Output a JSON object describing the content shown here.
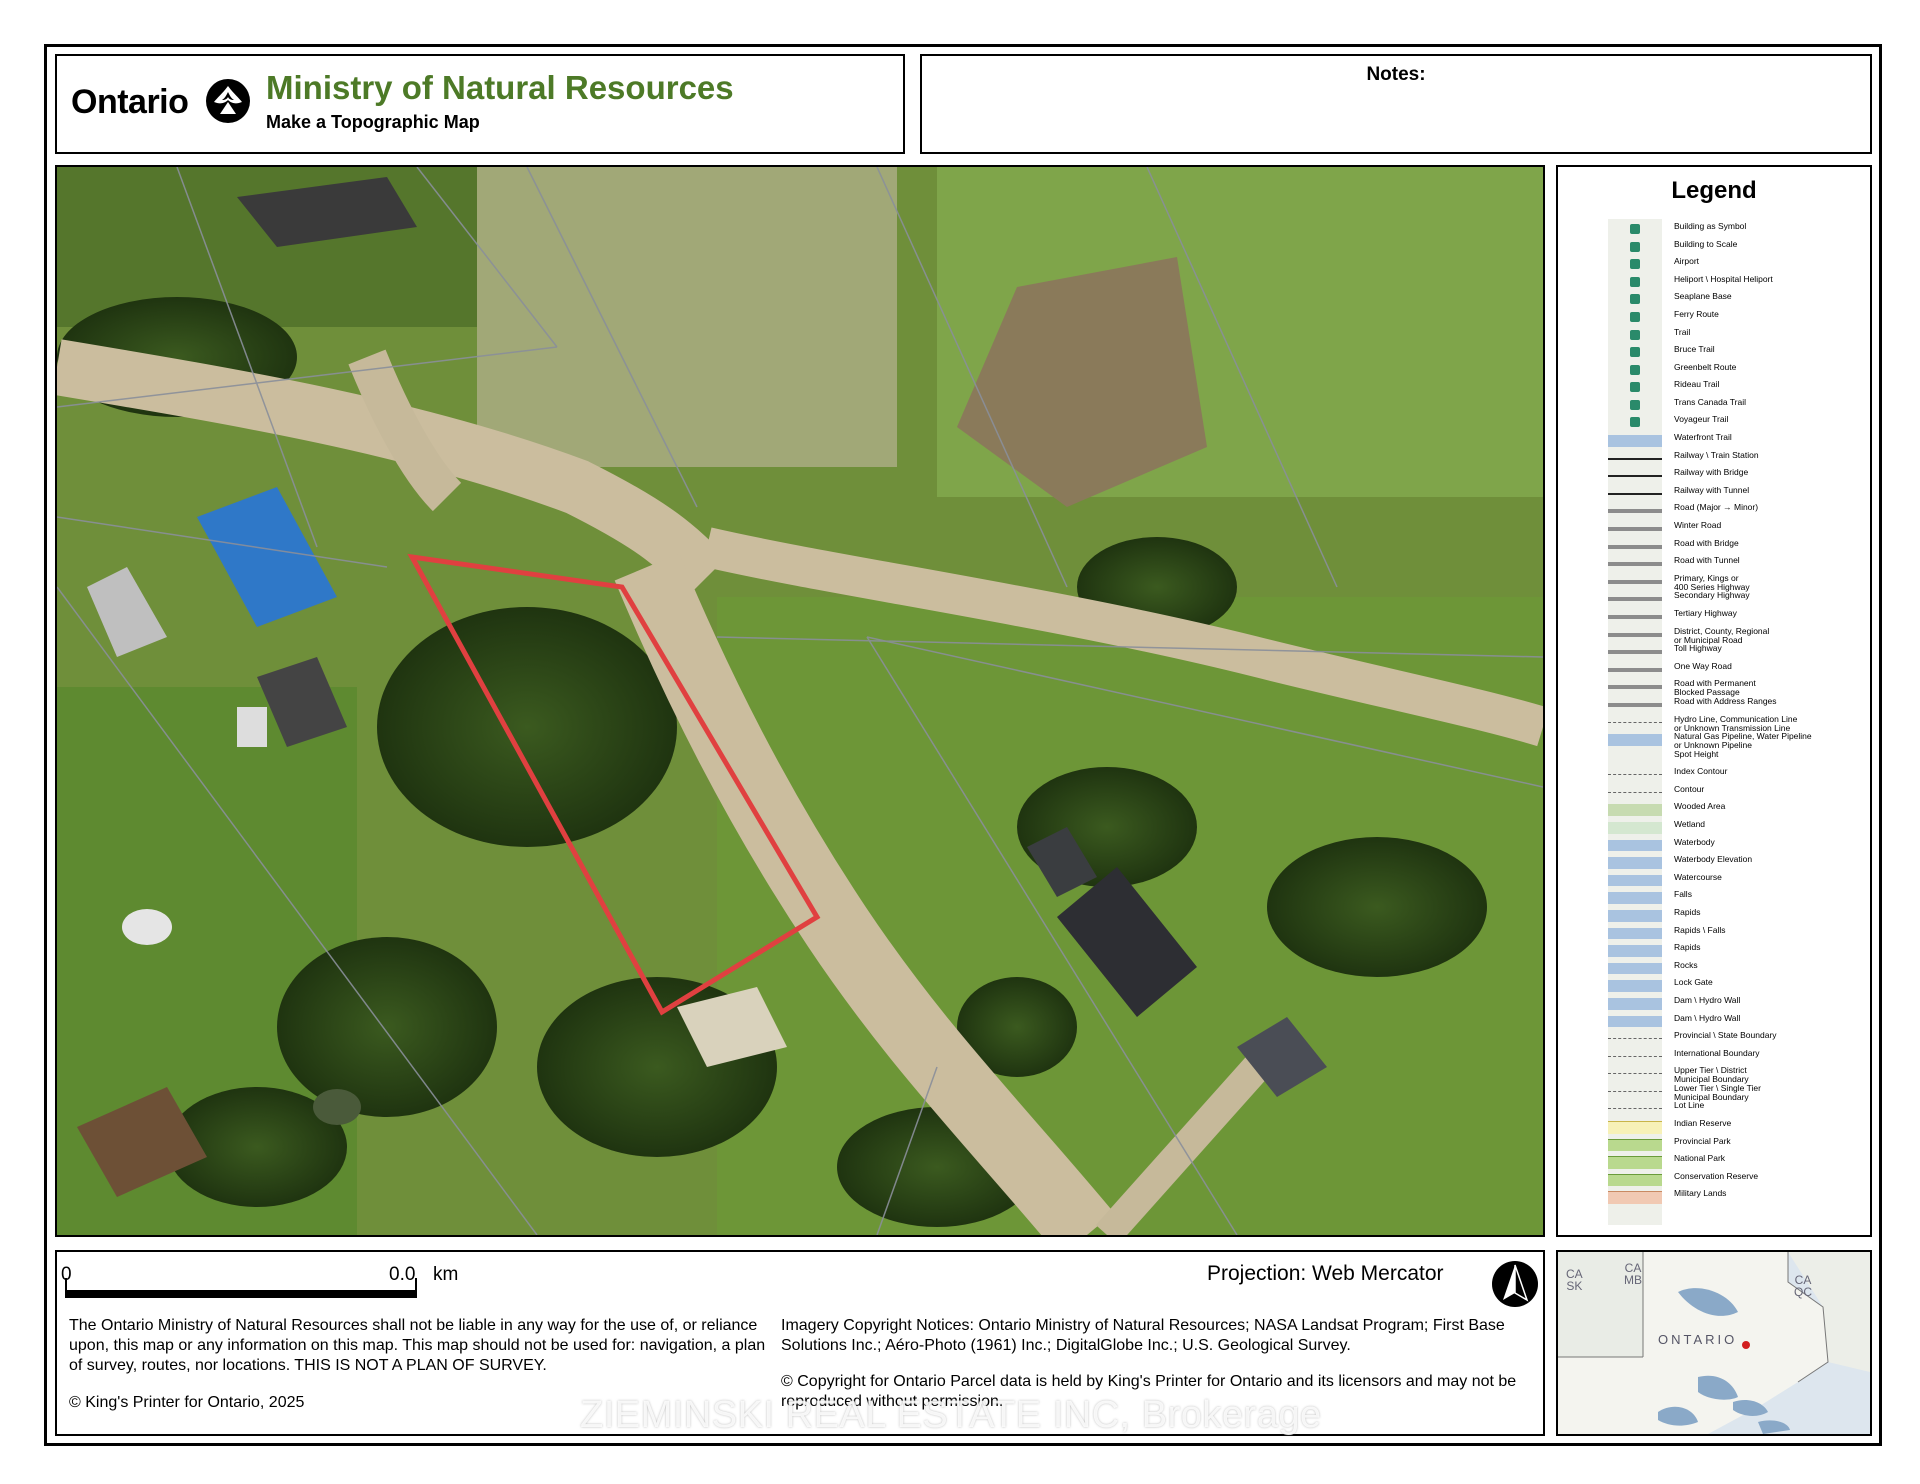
{
  "header": {
    "brand": "Ontario",
    "ministry": "Ministry of Natural Resources",
    "subtitle": "Make a Topographic Map"
  },
  "notes": {
    "label": "Notes:"
  },
  "legend": {
    "title": "Legend",
    "items": [
      "Building as Symbol",
      "Building to Scale",
      "Airport",
      "Heliport \\ Hospital Heliport",
      "Seaplane Base",
      "Ferry Route",
      "Trail",
      "Bruce Trail",
      "Greenbelt Route",
      "Rideau Trail",
      "Trans Canada Trail",
      "Voyageur Trail",
      "Waterfront Trail",
      "Railway \\ Train Station",
      "Railway with Bridge",
      "Railway with Tunnel",
      "Road (Major → Minor)",
      "Winter Road",
      "Road with Bridge",
      "Road with Tunnel",
      "Primary, Kings or\n400 Series Highway",
      "Secondary Highway",
      "Tertiary Highway",
      "District, County, Regional\nor Municipal Road",
      "Toll Highway",
      "One Way Road",
      "Road with Permanent\nBlocked Passage",
      "Road with Address Ranges",
      "Hydro Line, Communication Line\nor Unknown Transmission Line",
      "Natural Gas Pipeline, Water Pipeline\nor Unknown Pipeline",
      "Spot Height",
      "Index Contour",
      "Contour",
      "Wooded Area",
      "Wetland",
      "Waterbody",
      "Waterbody Elevation",
      "Watercourse",
      "Falls",
      "Rapids",
      "Rapids \\ Falls",
      "Rapids",
      "Rocks",
      "Lock Gate",
      "Dam \\ Hydro Wall",
      "Dam \\ Hydro Wall",
      "Provincial \\ State Boundary",
      "International Boundary",
      "Upper Tier \\ District\nMunicipal Boundary",
      "Lower Tier \\ Single Tier\nMunicipal Boundary",
      "Lot Line",
      "Indian Reserve",
      "Provincial Park",
      "National Park",
      "Conservation Reserve",
      "Military Lands"
    ]
  },
  "footer": {
    "scale_start": "0",
    "scale_end": "0.0",
    "scale_unit": "km",
    "projection": "Projection: Web Mercator",
    "disclaimer": "The Ontario Ministry of Natural Resources shall not be liable in any way for the use of, or reliance upon, this map or any information on this map.  This map should not be used for: navigation, a plan of survey, routes, nor locations. THIS IS NOT A PLAN OF SURVEY.",
    "copyright": "© King's Printer for Ontario,  2025",
    "imagery": "Imagery Copyright Notices: Ontario Ministry of Natural Resources; NASA Landsat Program; First Base Solutions Inc.; Aéro-Photo (1961) Inc.; DigitalGlobe Inc.; U.S. Geological Survey.",
    "parcel": "© Copyright for Ontario Parcel data is held by King's Printer for Ontario and its licensors and may not be reproduced without permission."
  },
  "inset": {
    "labels": [
      "CA\nSK",
      "CA\nMB",
      "CA\nQC"
    ],
    "ontario": "ONTARIO"
  },
  "watermark": "ZIEMINSKI REAL ESTATE INC, Brokerage",
  "colors": {
    "ministry_green": "#4d7a27",
    "parcel_outline": "#e04040"
  }
}
